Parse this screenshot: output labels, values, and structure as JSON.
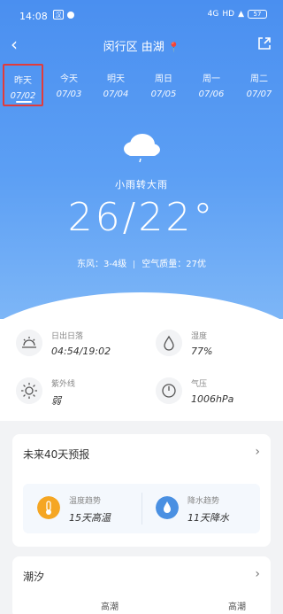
{
  "status_bar": {
    "time": "14:08",
    "app_icon_label": "汉",
    "signal_text": "4G",
    "hd_text": "HD",
    "battery": "57"
  },
  "header": {
    "location": "闵行区 由湖"
  },
  "days": [
    {
      "name": "昨天",
      "date": "07/02",
      "selected": true
    },
    {
      "name": "今天",
      "date": "07/03",
      "selected": false
    },
    {
      "name": "明天",
      "date": "07/04",
      "selected": false
    },
    {
      "name": "周日",
      "date": "07/05",
      "selected": false
    },
    {
      "name": "周一",
      "date": "07/06",
      "selected": false
    },
    {
      "name": "周二",
      "date": "07/07",
      "selected": false
    }
  ],
  "weather": {
    "condition": "小雨转大雨",
    "temperature": "26/22°",
    "wind": "东风：3-4级",
    "air_quality": "空气质量：27优"
  },
  "details": {
    "sunrise_label": "日出日落",
    "sunrise_value": "04:54/19:02",
    "humidity_label": "湿度",
    "humidity_value": "77%",
    "uv_label": "紫外线",
    "uv_value": "弱",
    "pressure_label": "气压",
    "pressure_value": "1006hPa"
  },
  "forecast_card": {
    "title": "未来40天预报",
    "temp_trend_label": "温度趋势",
    "temp_trend_value": "15天高温",
    "rain_trend_label": "降水趋势",
    "rain_trend_value": "11天降水"
  },
  "tide_card": {
    "title": "潮汐",
    "left_label": "高潮",
    "right_label": "高潮"
  },
  "colors": {
    "hero_top": "#4a8ff0",
    "hero_bottom": "#7db6f7",
    "selected_border": "#e23b3b",
    "temp_icon": "#f5a623",
    "rain_icon": "#4a90e2"
  }
}
